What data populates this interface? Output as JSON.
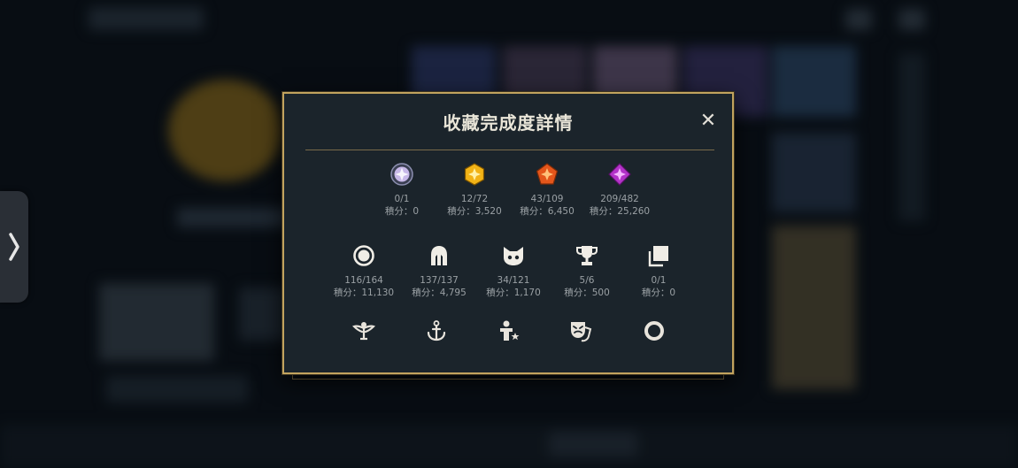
{
  "modal": {
    "title": "收藏完成度詳情",
    "close_label": "✕"
  },
  "row1": [
    {
      "icon": "clear-gem-icon",
      "count": "0/1",
      "points": "積分：0"
    },
    {
      "icon": "gold-gem-icon",
      "count": "12/72",
      "points": "積分：3,520"
    },
    {
      "icon": "orange-gem-icon",
      "count": "43/109",
      "points": "積分：6,450"
    },
    {
      "icon": "purple-gem-icon",
      "count": "209/482",
      "points": "積分：25,260"
    }
  ],
  "row2": [
    {
      "icon": "ring-icon",
      "count": "116/164",
      "points": "積分：11,130"
    },
    {
      "icon": "helmet-icon",
      "count": "137/137",
      "points": "積分：4,795"
    },
    {
      "icon": "cat-face-icon",
      "count": "34/121",
      "points": "積分：1,170"
    },
    {
      "icon": "trophy-icon",
      "count": "5/6",
      "points": "積分：500"
    },
    {
      "icon": "stacked-cards-icon",
      "count": "0/1",
      "points": "積分：0"
    }
  ],
  "row3": [
    "winged-emblem-icon",
    "anchor-icon",
    "person-star-icon",
    "theater-masks-icon",
    "ring-outline-icon"
  ],
  "colors": {
    "modal_border": "#c2a35e",
    "modal_bg": "#1b242b",
    "title_text": "#e9e5d8",
    "stat_text": "#9aa0a4"
  }
}
